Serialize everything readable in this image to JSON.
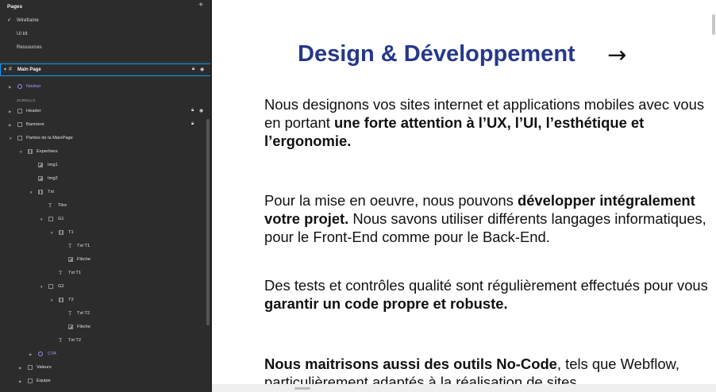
{
  "panel": {
    "pages_title": "Pages",
    "add_icon": "+",
    "pages": [
      {
        "label": "Wireframe",
        "active": true
      },
      {
        "label": "UI kit",
        "active": false
      },
      {
        "label": "Ressources",
        "active": false
      }
    ],
    "main_page": {
      "label": "Main Page",
      "lock_icon": "lock-icon",
      "eye_icon": "eye-icon"
    },
    "navbar": "Navbar",
    "scrolls_label": "SCROLLS",
    "layers": {
      "header": "Header",
      "banniere": "Banniere",
      "parties": "Parties de la MainPage",
      "expertises": "Expertises",
      "img1": "Img1",
      "img2": "Img2",
      "txt": "Txt",
      "titre": "Titre",
      "g1": "G1",
      "t1": "T1",
      "txt_t1_inner": "Txt T1",
      "fleche1": "Flèche",
      "txt_t1": "Txt T1",
      "g2": "G2",
      "t2": "T2",
      "txt_t2_inner": "Txt T2",
      "fleche2": "Flèche",
      "txt_t2": "Txt T2",
      "cta": "CTA",
      "valeurs": "Valeurs",
      "equipe": "Equipe"
    },
    "colors": {
      "selection": "#0d99ff",
      "component": "#a596ff",
      "panel_bg": "#2c2c2c"
    }
  },
  "preview": {
    "heading": "Design & Développement",
    "arrow": "→",
    "p1": {
      "a": "Nous designons vos sites internet et applications mobiles avec vous en portant ",
      "b": "une forte attention à l’UX, l’UI, l’esthétique et l’ergonomie."
    },
    "p2": {
      "a": "Pour la mise en oeuvre, nous pouvons ",
      "b": "développer intégralement votre projet.",
      "c": " Nous savons utiliser différents langages informatiques, pour le Front-End comme pour le Back-End."
    },
    "p3": {
      "a": "Des tests et contrôles qualité sont  régulièrement effectués pour vous ",
      "b": "garantir un code propre et robuste."
    },
    "p4": {
      "b": "Nous maitrisons aussi des outils No-Code",
      "a": ", tels que Webflow, particulièrement adaptés à la réalisation de sites"
    },
    "colors": {
      "heading": "#25388a",
      "text": "#111111"
    }
  }
}
